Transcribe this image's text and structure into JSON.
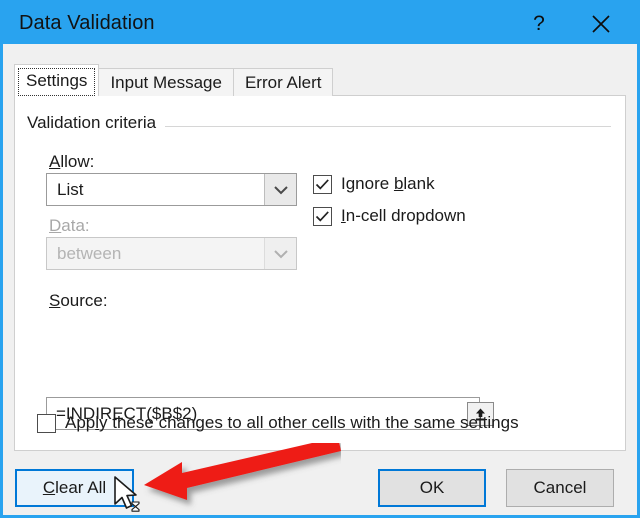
{
  "window": {
    "title": "Data Validation",
    "help_icon": "question-mark-icon",
    "help_label": "?",
    "close_icon": "close-x-icon",
    "titlebar_color": "#29a3ef"
  },
  "tabs": [
    {
      "label": "Settings",
      "active": true
    },
    {
      "label": "Input Message",
      "active": false
    },
    {
      "label": "Error Alert",
      "active": false
    }
  ],
  "settings": {
    "group_title": "Validation criteria",
    "allow": {
      "label": "Allow:",
      "accelerator": "A",
      "value": "List",
      "enabled": true
    },
    "data": {
      "label": "Data:",
      "accelerator": "D",
      "value": "between",
      "enabled": false
    },
    "source": {
      "label": "Source:",
      "accelerator": "S",
      "value": "=INDIRECT($B$2)",
      "picker_icon": "range-selector-icon"
    },
    "ignore_blank": {
      "label_before": "Ignore ",
      "accelerator": "b",
      "label_after": "lank",
      "checked": true
    },
    "in_cell_dropdown": {
      "label_before": "",
      "accelerator": "I",
      "label_after": "n-cell dropdown",
      "checked": true
    },
    "apply_all": {
      "label_before": "App",
      "accelerator": "l",
      "label_after": "y these changes to all other cells with the same settings",
      "checked": false
    }
  },
  "buttons": {
    "clear_all": {
      "label_before": "",
      "accelerator": "C",
      "label_after": "lear All",
      "state": "hover"
    },
    "ok": {
      "label": "OK",
      "state": "default"
    },
    "cancel": {
      "label": "Cancel",
      "state": "normal"
    }
  },
  "annotation": {
    "arrow_icon": "red-arrow-left-icon",
    "arrow_color": "#ee1b18",
    "cursor_icon": "mouse-pointer-icon"
  }
}
